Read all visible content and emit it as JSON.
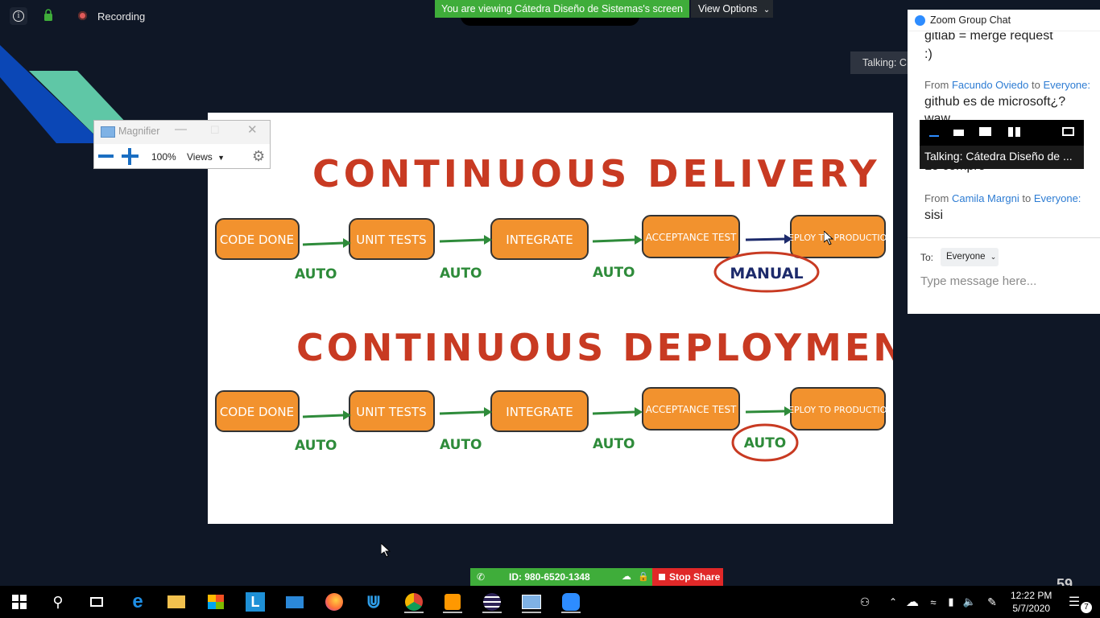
{
  "top": {
    "recording_label": "Recording",
    "viewing_banner": "You are viewing Cátedra Diseño de Sistemas's screen",
    "view_options_label": "View Options",
    "talking_label": "Talking: C"
  },
  "magnifier": {
    "title": "Magnifier",
    "zoom_percent": "100%",
    "views_label": "Views"
  },
  "slide": {
    "title_delivery": "CONTINUOUS DELIVERY",
    "title_deployment": "CONTINUOUS DEPLOYMENT",
    "steps": [
      "CODE DONE",
      "UNIT TESTS",
      "INTEGRATE",
      "ACCEPTANCE TEST",
      "DEPLOY TO PRODUCTION"
    ],
    "auto_label": "AUTO",
    "manual_label": "MANUAL"
  },
  "chat": {
    "title": "Zoom Group Chat",
    "top_msg_1": "gitlab = merge request",
    "top_msg_2": ":)",
    "from_word": "From",
    "to_word": "to",
    "everyone": "Everyone:",
    "sender_1": "Facundo Oviedo",
    "msg_1": "github es de microsoft¿?",
    "msg_1b": "waw",
    "msg_hidden": "Lo compro",
    "sender_2": "Camila Margni",
    "msg_2": "sisi",
    "to_label": "To:",
    "to_value": "Everyone",
    "input_placeholder": "Type message here..."
  },
  "video_overlay": {
    "talking": "Talking: Cátedra Diseño de ..."
  },
  "meeting_bar": {
    "meeting_id": "ID: 980-6520-1348",
    "stop_share_label": "Stop Share",
    "corner_number": "59"
  },
  "taskbar": {
    "time": "12:22 PM",
    "date": "5/7/2020",
    "notification_count": "7"
  },
  "colors": {
    "zoom_green": "#3fad3a",
    "stop_red": "#e02828",
    "slide_orange": "#f2922e",
    "slide_red_text": "#c83a22",
    "arrow_green": "#2e8b3a",
    "manual_blue": "#1c2a6b"
  }
}
